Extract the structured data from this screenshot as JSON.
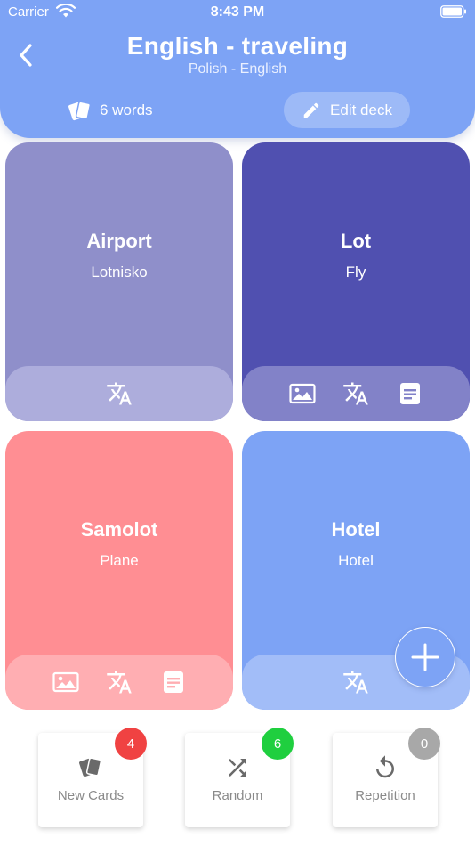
{
  "status": {
    "carrier": "Carrier",
    "time": "8:43 PM"
  },
  "header": {
    "title": "English - traveling",
    "subtitle": "Polish - English",
    "word_count": "6 words",
    "edit_label": "Edit deck"
  },
  "cards": [
    {
      "word": "Airport",
      "translation": "Lotnisko",
      "icons": [
        "translate-icon"
      ],
      "color": "#8f8fca"
    },
    {
      "word": "Lot",
      "translation": "Fly",
      "icons": [
        "image-icon",
        "translate-icon",
        "notes-icon"
      ],
      "color": "#5050b0"
    },
    {
      "word": "Samolot",
      "translation": "Plane",
      "icons": [
        "image-icon",
        "translate-icon",
        "notes-icon"
      ],
      "color": "#ff8e93"
    },
    {
      "word": "Hotel",
      "translation": "Hotel",
      "icons": [
        "translate-icon"
      ],
      "color": "#7da3f5"
    }
  ],
  "modes": [
    {
      "label": "New Cards",
      "badge": "4",
      "badge_color": "#f04242",
      "icon": "cards-icon"
    },
    {
      "label": "Random",
      "badge": "6",
      "badge_color": "#1fcf3f",
      "icon": "shuffle-icon"
    },
    {
      "label": "Repetition",
      "badge": "0",
      "badge_color": "#a8a8a8",
      "icon": "repeat-icon"
    }
  ],
  "colors": {
    "accent": "#7da3f5"
  }
}
